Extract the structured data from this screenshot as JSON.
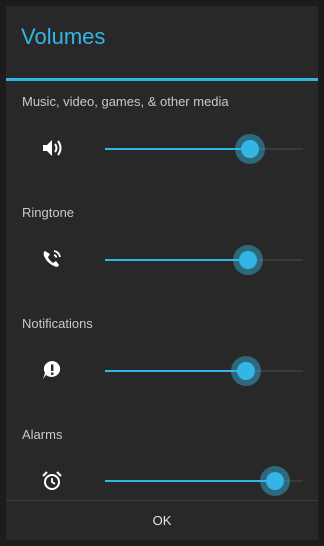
{
  "dialog": {
    "title": "Volumes",
    "ok_label": "OK"
  },
  "streams": [
    {
      "label": "Music, video, games, & other media",
      "icon": "speaker-volume-icon",
      "level": 0.73
    },
    {
      "label": "Ringtone",
      "icon": "phone-ring-icon",
      "level": 0.72
    },
    {
      "label": "Notifications",
      "icon": "notification-alert-icon",
      "level": 0.71
    },
    {
      "label": "Alarms",
      "icon": "alarm-clock-icon",
      "level": 0.86
    }
  ],
  "colors": {
    "accent": "#33b5e5",
    "background": "#282828"
  }
}
